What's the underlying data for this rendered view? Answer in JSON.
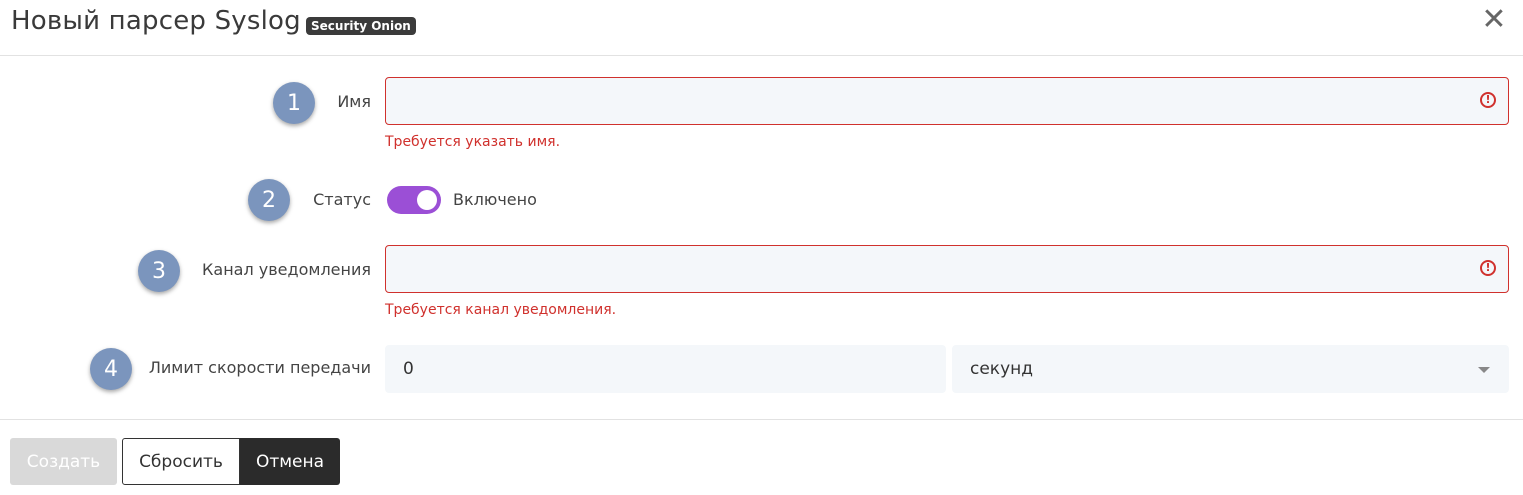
{
  "header": {
    "title": "Новый парсер Syslog",
    "badge": "Security Onion",
    "close_icon": "close-icon"
  },
  "form": {
    "name": {
      "step": "1",
      "label": "Имя",
      "value": "",
      "error": "Требуется указать имя.",
      "error_icon": "exclamation-circle-icon"
    },
    "status": {
      "step": "2",
      "label": "Статус",
      "enabled": true,
      "state_text": "Включено"
    },
    "channel": {
      "step": "3",
      "label": "Канал уведомления",
      "value": "",
      "error": "Требуется канал уведомления.",
      "error_icon": "exclamation-circle-icon"
    },
    "rate_limit": {
      "step": "4",
      "label": "Лимит скорости передачи",
      "value": "0",
      "unit": "секунд"
    }
  },
  "footer": {
    "create_label": "Создать",
    "reset_label": "Сбросить",
    "cancel_label": "Отмена"
  },
  "colors": {
    "accent_toggle": "#9b4fd6",
    "error": "#d0312d",
    "step_badge": "#7b95bd",
    "cancel_bg": "#2b2b2b"
  }
}
